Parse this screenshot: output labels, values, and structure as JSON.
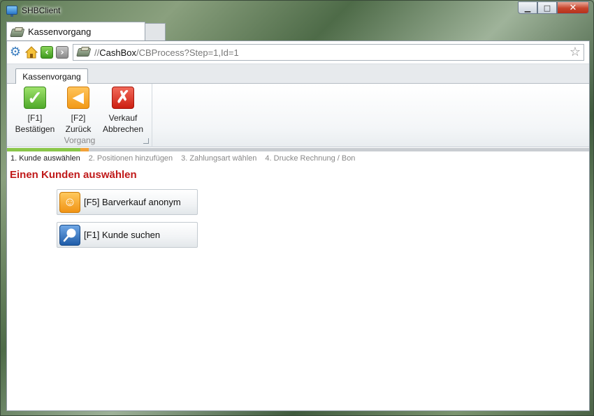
{
  "window": {
    "title": "SHBClient",
    "controls": {
      "minimize": "▁",
      "maximize": "□",
      "close": "✕"
    }
  },
  "browser": {
    "tab_label": "Kassenvorgang",
    "url_prefix": "//",
    "url_host": "CashBox",
    "url_rest": "/CBProcess?Step=1,Id=1",
    "icons": [
      "settings-icon",
      "home-icon",
      "back-icon",
      "forward-icon",
      "register-icon",
      "favorite-star-icon"
    ]
  },
  "ribbon": {
    "tab_label": "Kassenvorgang",
    "group_label": "Vorgang",
    "buttons": [
      {
        "key": "[F1]",
        "label": "Bestätigen",
        "icon": "checkmark-icon",
        "color": "#4fa92a"
      },
      {
        "key": "[F2]",
        "label": "Zurück",
        "icon": "back-arrow-icon",
        "color": "#f29a17"
      },
      {
        "key": "Verkauf",
        "label": "Abbrechen",
        "icon": "cancel-x-icon",
        "color": "#cc1f12"
      }
    ]
  },
  "progress": {
    "current_step": 1,
    "total_steps": 4
  },
  "steps": [
    "1. Kunde auswählen",
    "2. Positionen hinzufügen",
    "3. Zahlungsart wählen",
    "4. Drucke Rechnung / Bon"
  ],
  "main": {
    "title": "Einen Kunden auswählen",
    "title_color": "#c01a1a",
    "actions": [
      {
        "label": "[F5] Barverkauf anonym",
        "icon": "anonymous-smiley-icon"
      },
      {
        "label": "[F1] Kunde suchen",
        "icon": "search-magnifier-icon"
      }
    ]
  }
}
